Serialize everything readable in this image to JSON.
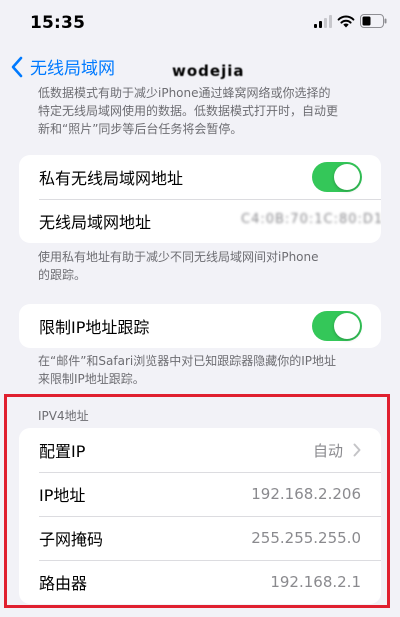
{
  "status_bar": {
    "time": "15:35",
    "icons": [
      "signal-icon",
      "wifi-icon",
      "battery-icon"
    ]
  },
  "nav": {
    "back_label": "无线局域网",
    "title": "wodejia"
  },
  "low_data_note": {
    "lines": [
      "低数据模式有助于减少iPhone通过蜂窝网络或你选择的",
      "特定无线局域网使用的数据。低数据模式打开时，自动更",
      "新和“照片”同步等后台任务将会暂停。"
    ]
  },
  "private_address_card": {
    "toggle_label": "私有无线局域网地址",
    "toggle_on": true,
    "mac_label": "无线局域网地址",
    "mac_value": "C4:0B:70:1C:80:D1"
  },
  "private_address_note": {
    "lines": [
      "使用私有地址有助于减少不同无线局域网间对iPhone",
      "的跟踪。"
    ]
  },
  "ip_tracking_card": {
    "toggle_label": "限制IP地址跟踪",
    "toggle_on": true
  },
  "ip_tracking_note": {
    "lines": [
      "在“邮件”和Safari浏览器中对已知跟踪器隐藏你的IP地址",
      "来限制IP地址跟踪。"
    ]
  },
  "ipv4": {
    "header": "IPV4地址",
    "configure_label": "配置IP",
    "configure_value": "自动",
    "ip_label": "IP地址",
    "ip_value": "192.168.2.206",
    "subnet_label": "子网掩码",
    "subnet_value": "255.255.255.0",
    "router_label": "路由器",
    "router_value": "192.168.2.1"
  },
  "colors": {
    "accent": "#007aff",
    "toggle_on": "#34c759",
    "highlight": "#e0202f",
    "background": "#f2f2f7"
  }
}
